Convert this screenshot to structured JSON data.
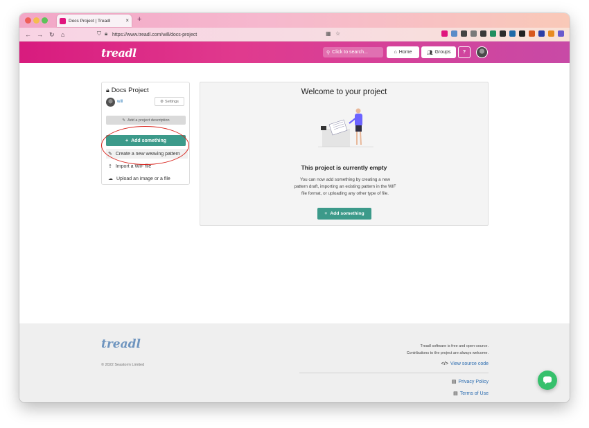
{
  "browser": {
    "tab_title": "Docs Project | Treadl",
    "new_tab": "+",
    "url": "https://www.treadl.com/will/docs-project",
    "extension_colors": [
      "#e0157e",
      "#5a8cc8",
      "#444444",
      "#7a7a7a",
      "#3a3a3a",
      "#1f8f5f",
      "#2c2c2c",
      "#1e6aa8",
      "#222222",
      "#d8581f",
      "#2c3ea8",
      "#e98b1f",
      "#6a5acd"
    ]
  },
  "header": {
    "logo": "treadl",
    "search_placeholder": "Click to search...",
    "home_label": "Home",
    "groups_label": "Groups",
    "help_label": "?"
  },
  "sidebar": {
    "project_title": "Docs Project",
    "user": "will",
    "settings_label": "Settings",
    "description_label": "Add a project description",
    "add_label": "Add something",
    "menu": [
      {
        "label": "Create a new weaving pattern",
        "icon": "pencil-icon"
      },
      {
        "label": "Import a WIF file",
        "icon": "upload-icon"
      },
      {
        "label": "Upload an image or a file",
        "icon": "cloud-upload-icon"
      }
    ]
  },
  "panel": {
    "title": "Welcome to your project",
    "empty_title": "This project is currently empty",
    "empty_text": "You can now add something by creating a new pattern draft, importing an existing pattern in the WIF file format, or uploading any other type of file.",
    "add_label": "Add something"
  },
  "footer": {
    "logo": "treadl",
    "copyright": "© 2022 Seastorm Limited",
    "free_text": "Treadl software is free and open-source.",
    "contrib_text": "Contributions to the project are always welcome.",
    "source_link": "View source code",
    "privacy_link": "Privacy Policy",
    "terms_link": "Terms of Use"
  },
  "colors": {
    "accent": "#3c9a8a",
    "header": "#d81b7e",
    "link": "#2b6cb0",
    "chat": "#36c06c",
    "annotation": "#d8231c"
  }
}
